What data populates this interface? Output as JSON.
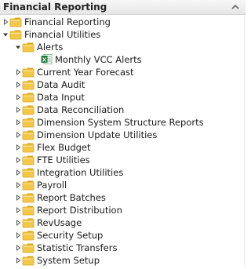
{
  "panel": {
    "title": "Financial Reporting",
    "collapse_icon": "chevron-up-icon"
  },
  "tree": [
    {
      "label": "Financial Reporting",
      "level": 0,
      "type": "folder",
      "state": "collapsed"
    },
    {
      "label": "Financial Utilities",
      "level": 0,
      "type": "folder",
      "state": "expanded"
    },
    {
      "label": "Alerts",
      "level": 1,
      "type": "folder",
      "state": "expanded"
    },
    {
      "label": "Monthly VCC Alerts",
      "level": 2,
      "type": "excel-report",
      "state": "leaf"
    },
    {
      "label": "Current Year Forecast",
      "level": 1,
      "type": "folder",
      "state": "collapsed"
    },
    {
      "label": "Data Audit",
      "level": 1,
      "type": "folder",
      "state": "collapsed"
    },
    {
      "label": "Data Input",
      "level": 1,
      "type": "folder",
      "state": "collapsed"
    },
    {
      "label": "Data Reconciliation",
      "level": 1,
      "type": "folder",
      "state": "collapsed"
    },
    {
      "label": "Dimension System Structure Reports",
      "level": 1,
      "type": "folder",
      "state": "collapsed"
    },
    {
      "label": "Dimension Update Utilities",
      "level": 1,
      "type": "folder",
      "state": "collapsed"
    },
    {
      "label": "Flex Budget",
      "level": 1,
      "type": "folder",
      "state": "collapsed"
    },
    {
      "label": "FTE Utilities",
      "level": 1,
      "type": "folder",
      "state": "collapsed"
    },
    {
      "label": "Integration Utilities",
      "level": 1,
      "type": "folder",
      "state": "collapsed"
    },
    {
      "label": "Payroll",
      "level": 1,
      "type": "folder",
      "state": "collapsed"
    },
    {
      "label": "Report Batches",
      "level": 1,
      "type": "folder",
      "state": "collapsed"
    },
    {
      "label": "Report Distribution",
      "level": 1,
      "type": "folder",
      "state": "collapsed"
    },
    {
      "label": "RevUsage",
      "level": 1,
      "type": "folder",
      "state": "collapsed"
    },
    {
      "label": "Security Setup",
      "level": 1,
      "type": "folder",
      "state": "collapsed"
    },
    {
      "label": "Statistic Transfers",
      "level": 1,
      "type": "folder",
      "state": "collapsed"
    },
    {
      "label": "System Setup",
      "level": 1,
      "type": "folder",
      "state": "collapsed"
    }
  ],
  "colors": {
    "folder": "#f2c84b",
    "folder_dark": "#d9a520",
    "excel": "#1f7a3c"
  }
}
